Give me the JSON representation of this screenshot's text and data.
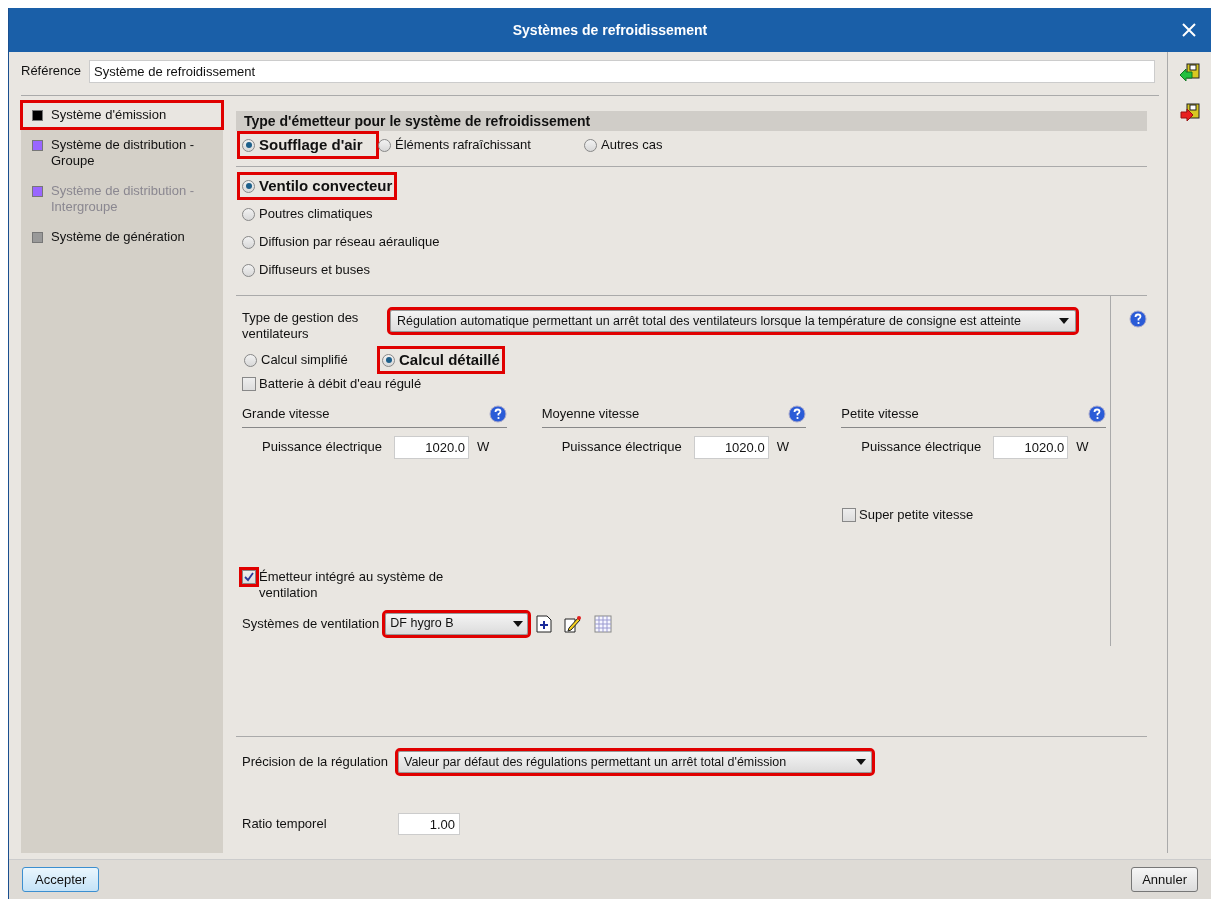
{
  "window": {
    "title": "Systèmes de refroidissement"
  },
  "reference": {
    "label": "Référence",
    "value": "Système de refroidissement"
  },
  "sidebar": {
    "items": [
      {
        "label": "Système d'émission",
        "color": "#000000",
        "selected": true,
        "disabled": false,
        "highlighted": true
      },
      {
        "label": "Système de distribution - Groupe",
        "color": "#9966ff",
        "selected": false,
        "disabled": false,
        "highlighted": false
      },
      {
        "label": "Système de distribution - Intergroupe",
        "color": "#9966ff",
        "selected": false,
        "disabled": true,
        "highlighted": false
      },
      {
        "label": "Système de génération",
        "color": "#999999",
        "selected": false,
        "disabled": false,
        "highlighted": false
      }
    ]
  },
  "emitter_type": {
    "title": "Type d'émetteur pour le système de refroidissement",
    "options": [
      {
        "label": "Soufflage d'air",
        "selected": true,
        "highlighted": true
      },
      {
        "label": "Éléments rafraîchissant",
        "selected": false,
        "highlighted": false
      },
      {
        "label": "Autres cas",
        "selected": false,
        "highlighted": false
      }
    ]
  },
  "emitter_subtypes": [
    {
      "label": "Ventilo convecteur",
      "selected": true,
      "highlighted": true
    },
    {
      "label": "Poutres climatiques",
      "selected": false,
      "highlighted": false
    },
    {
      "label": "Diffusion par réseau aéraulique",
      "selected": false,
      "highlighted": false
    },
    {
      "label": "Diffuseurs et buses",
      "selected": false,
      "highlighted": false
    }
  ],
  "fan_management": {
    "label": "Type de gestion des ventilateurs",
    "value": "Régulation automatique permettant un arrêt total des ventilateurs lorsque la température de consigne est atteinte",
    "highlighted": true
  },
  "calc_modes": [
    {
      "label": "Calcul simplifié",
      "selected": false,
      "highlighted": false
    },
    {
      "label": "Calcul détaillé",
      "selected": true,
      "highlighted": true
    }
  ],
  "battery": {
    "label": "Batterie à débit d'eau régulé",
    "checked": false
  },
  "speeds": [
    {
      "title": "Grande vitesse",
      "field_label": "Puissance électrique",
      "value": "1020.0",
      "unit": "W"
    },
    {
      "title": "Moyenne vitesse",
      "field_label": "Puissance électrique",
      "value": "1020.0",
      "unit": "W"
    },
    {
      "title": "Petite vitesse",
      "field_label": "Puissance électrique",
      "value": "1020.0",
      "unit": "W"
    }
  ],
  "super_low_speed": {
    "label": "Super petite vitesse",
    "checked": false
  },
  "integrated_emitter": {
    "label": "Émetteur intégré au système de ventilation",
    "checked": true,
    "highlighted": true
  },
  "ventilation_systems": {
    "label": "Systèmes de ventilation",
    "value": "DF hygro B",
    "highlighted": true
  },
  "regulation_precision": {
    "label": "Précision de la régulation",
    "value": "Valeur par défaut des régulations permettant un arrêt total d'émission",
    "highlighted": true
  },
  "time_ratio": {
    "label": "Ratio temporel",
    "value": "1.00"
  },
  "buttons": {
    "accept": "Accepter",
    "cancel": "Annuler"
  }
}
